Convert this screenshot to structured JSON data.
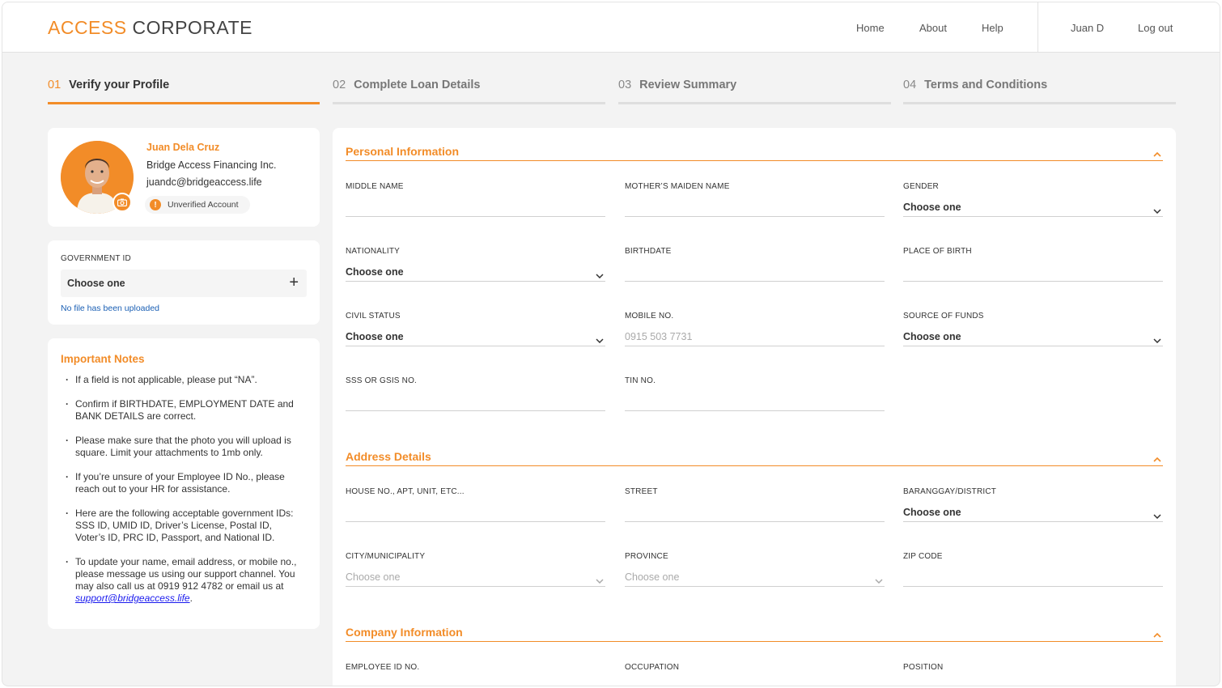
{
  "header": {
    "logo_accent": "ACCESS",
    "logo_rest": "CORPORATE",
    "nav": [
      "Home",
      "About",
      "Help"
    ],
    "user": "Juan D",
    "logout": "Log out"
  },
  "steps": [
    {
      "num": "01",
      "label": "Verify your Profile",
      "active": true
    },
    {
      "num": "02",
      "label": "Complete Loan Details",
      "active": false
    },
    {
      "num": "03",
      "label": "Review Summary",
      "active": false
    },
    {
      "num": "04",
      "label": "Terms and Conditions",
      "active": false
    }
  ],
  "profile": {
    "name": "Juan Dela Cruz",
    "company": "Bridge Access Financing Inc.",
    "email": "juandc@bridgeaccess.life",
    "status": "Unverified Account"
  },
  "government_id": {
    "label": "GOVERNMENT ID",
    "value": "Choose one",
    "upload_status": "No file has been uploaded"
  },
  "notes": {
    "title": "Important Notes",
    "items": [
      "If a field is not applicable, please put “NA”.",
      "Confirm if BIRTHDATE, EMPLOYMENT DATE and BANK DETAILS are correct.",
      "Please make sure that the photo you will upload is square. Limit your attachments to 1mb only.",
      "If you’re unsure of your Employee ID No., please reach out to your HR for assistance.",
      "Here are the following acceptable government IDs: SSS ID, UMID ID, Driver’s License, Postal ID, Voter’s ID, PRC ID, Passport, and National ID."
    ],
    "last_item_text": "To update your name, email address, or mobile no., please message us using our support channel. You may also call us at 0919 912 4782 or email us at ",
    "last_item_link": "support@bridgeaccess.life"
  },
  "sections": {
    "personal": {
      "title": "Personal Information",
      "fields": {
        "middle_name": {
          "label": "MIDDLE NAME",
          "value": ""
        },
        "maiden_name": {
          "label": "MOTHER’S MAIDEN NAME",
          "value": ""
        },
        "gender": {
          "label": "GENDER",
          "value": "Choose one"
        },
        "nationality": {
          "label": "NATIONALITY",
          "value": "Choose one"
        },
        "birthdate": {
          "label": "BIRTHDATE",
          "value": ""
        },
        "birthplace": {
          "label": "PLACE OF BIRTH",
          "value": ""
        },
        "civil_status": {
          "label": "CIVIL STATUS",
          "value": "Choose one"
        },
        "mobile": {
          "label": "MOBILE NO.",
          "placeholder": "0915 503 7731"
        },
        "source_funds": {
          "label": "SOURCE OF FUNDS",
          "value": "Choose one"
        },
        "sss": {
          "label": "SSS OR GSIS NO.",
          "value": ""
        },
        "tin": {
          "label": "TIN NO.",
          "value": ""
        }
      }
    },
    "address": {
      "title": "Address Details",
      "fields": {
        "house": {
          "label": "HOUSE NO., APT, UNIT, ETC...",
          "value": ""
        },
        "street": {
          "label": "STREET",
          "value": ""
        },
        "barangay": {
          "label": "BARANGGAY/DISTRICT",
          "value": "Choose one"
        },
        "city": {
          "label": "CITY/MUNICIPALITY",
          "placeholder": "Choose one"
        },
        "province": {
          "label": "PROVINCE",
          "placeholder": "Choose one"
        },
        "zip": {
          "label": "ZIP CODE",
          "value": ""
        }
      }
    },
    "company": {
      "title": "Company Information",
      "fields": {
        "employee_id": {
          "label": "EMPLOYEE ID NO."
        },
        "occupation": {
          "label": "OCCUPATION"
        },
        "position": {
          "label": "POSITION"
        }
      }
    }
  },
  "colors": {
    "accent": "#f28c28",
    "link": "#1a5fb4"
  },
  "icons": [
    "camera-icon",
    "warning-icon",
    "plus-icon",
    "chevron-down-icon",
    "chevron-up-icon"
  ]
}
